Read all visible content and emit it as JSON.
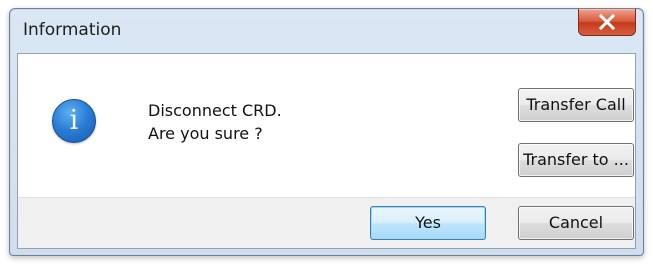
{
  "dialog": {
    "title": "Information",
    "close_icon": "close-x-icon",
    "icon": "information-icon",
    "icon_glyph": "i",
    "message_lines": [
      "Disconnect CRD.",
      "Are you sure ?"
    ],
    "buttons": {
      "transfer_call": "Transfer Call",
      "transfer_to": "Transfer to ...",
      "yes": "Yes",
      "cancel": "Cancel"
    }
  },
  "colors": {
    "close_button": "#c23a1b",
    "info_icon": "#2c7fd6",
    "default_button_border": "#3c7fb1"
  }
}
